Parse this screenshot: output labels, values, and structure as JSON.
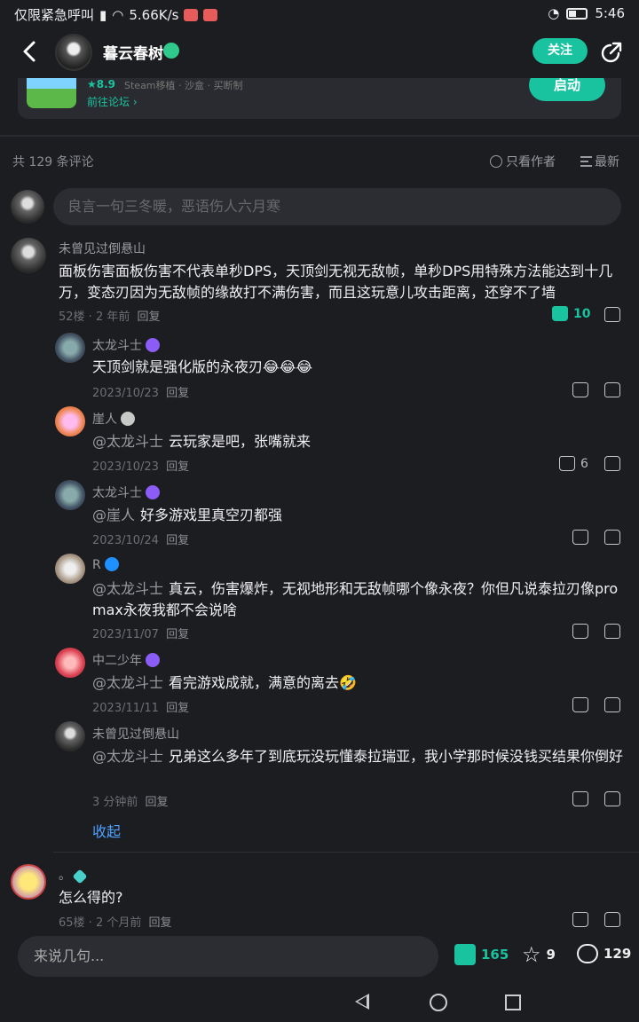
{
  "status_bar": {
    "left_text": "仅限紧急呼叫",
    "net_speed": "5.66K/s",
    "time": "5:46"
  },
  "header": {
    "title": "暮云春树",
    "follow_label": "关注"
  },
  "game_card": {
    "score": "★8.9",
    "meta": "Steam移植 · 沙盒 · 买断制",
    "forum_link": "前往论坛 ›",
    "launch_label": "启动"
  },
  "comments_bar": {
    "count_text": "共 129 条评论",
    "author_only": "只看作者",
    "latest": "最新"
  },
  "comment_input": {
    "placeholder": "良言一句三冬暖，恶语伤人六月寒"
  },
  "main_comment": {
    "user": "未曾见过倒悬山",
    "text": "面板伤害面板伤害不代表单秒DPS，天顶剑无视无敌帧，单秒DPS用特殊方法能达到十几万，变态刃因为无敌帧的缘故打不满伤害，而且这玩意儿攻击距离，还穿不了墙",
    "floor": "52楼 · 2 年前",
    "reply": "回复",
    "likes": "10"
  },
  "replies": [
    {
      "user": "太龙斗士",
      "mention": "",
      "text": "天顶剑就是强化版的永夜刃😂😂😂",
      "date": "2023/10/23",
      "reply": "回复",
      "likes": ""
    },
    {
      "user": "崖人",
      "mention": "@太龙斗士",
      "text": "云玩家是吧，张嘴就来",
      "date": "2023/10/23",
      "reply": "回复",
      "likes": "6"
    },
    {
      "user": "太龙斗士",
      "mention": "@崖人",
      "text": "好多游戏里真空刃都强",
      "date": "2023/10/24",
      "reply": "回复",
      "likes": ""
    },
    {
      "user": "R",
      "mention": "@太龙斗士",
      "text": "真云，伤害爆炸，无视地形和无敌帧哪个像永夜？你但凡说泰拉刃像pro max永夜我都不会说啥",
      "date": "2023/11/07",
      "reply": "回复",
      "likes": ""
    },
    {
      "user": "中二少年",
      "mention": "@太龙斗士",
      "text": "看完游戏成就，满意的离去🤣",
      "date": "2023/11/11",
      "reply": "回复",
      "likes": ""
    },
    {
      "user": "未曾见过倒悬山",
      "mention": "@太龙斗士",
      "text": "兄弟这么多年了到底玩没玩懂泰拉瑞亚，我小学那时候没钱买结果你倒好",
      "date": "3 分钟前",
      "reply": "回复",
      "likes": ""
    }
  ],
  "collapse_label": "收起",
  "next_comment": {
    "user": "。",
    "text": "怎么得的?",
    "floor": "65楼 · 2 个月前",
    "reply": "回复"
  },
  "bottom_bar": {
    "placeholder": "来说几句...",
    "likes": "165",
    "favorites": "9",
    "comments": "129"
  },
  "colors": {
    "accent": "#19c3a0",
    "link": "#4ea1ff",
    "background": "#1c1d21"
  }
}
